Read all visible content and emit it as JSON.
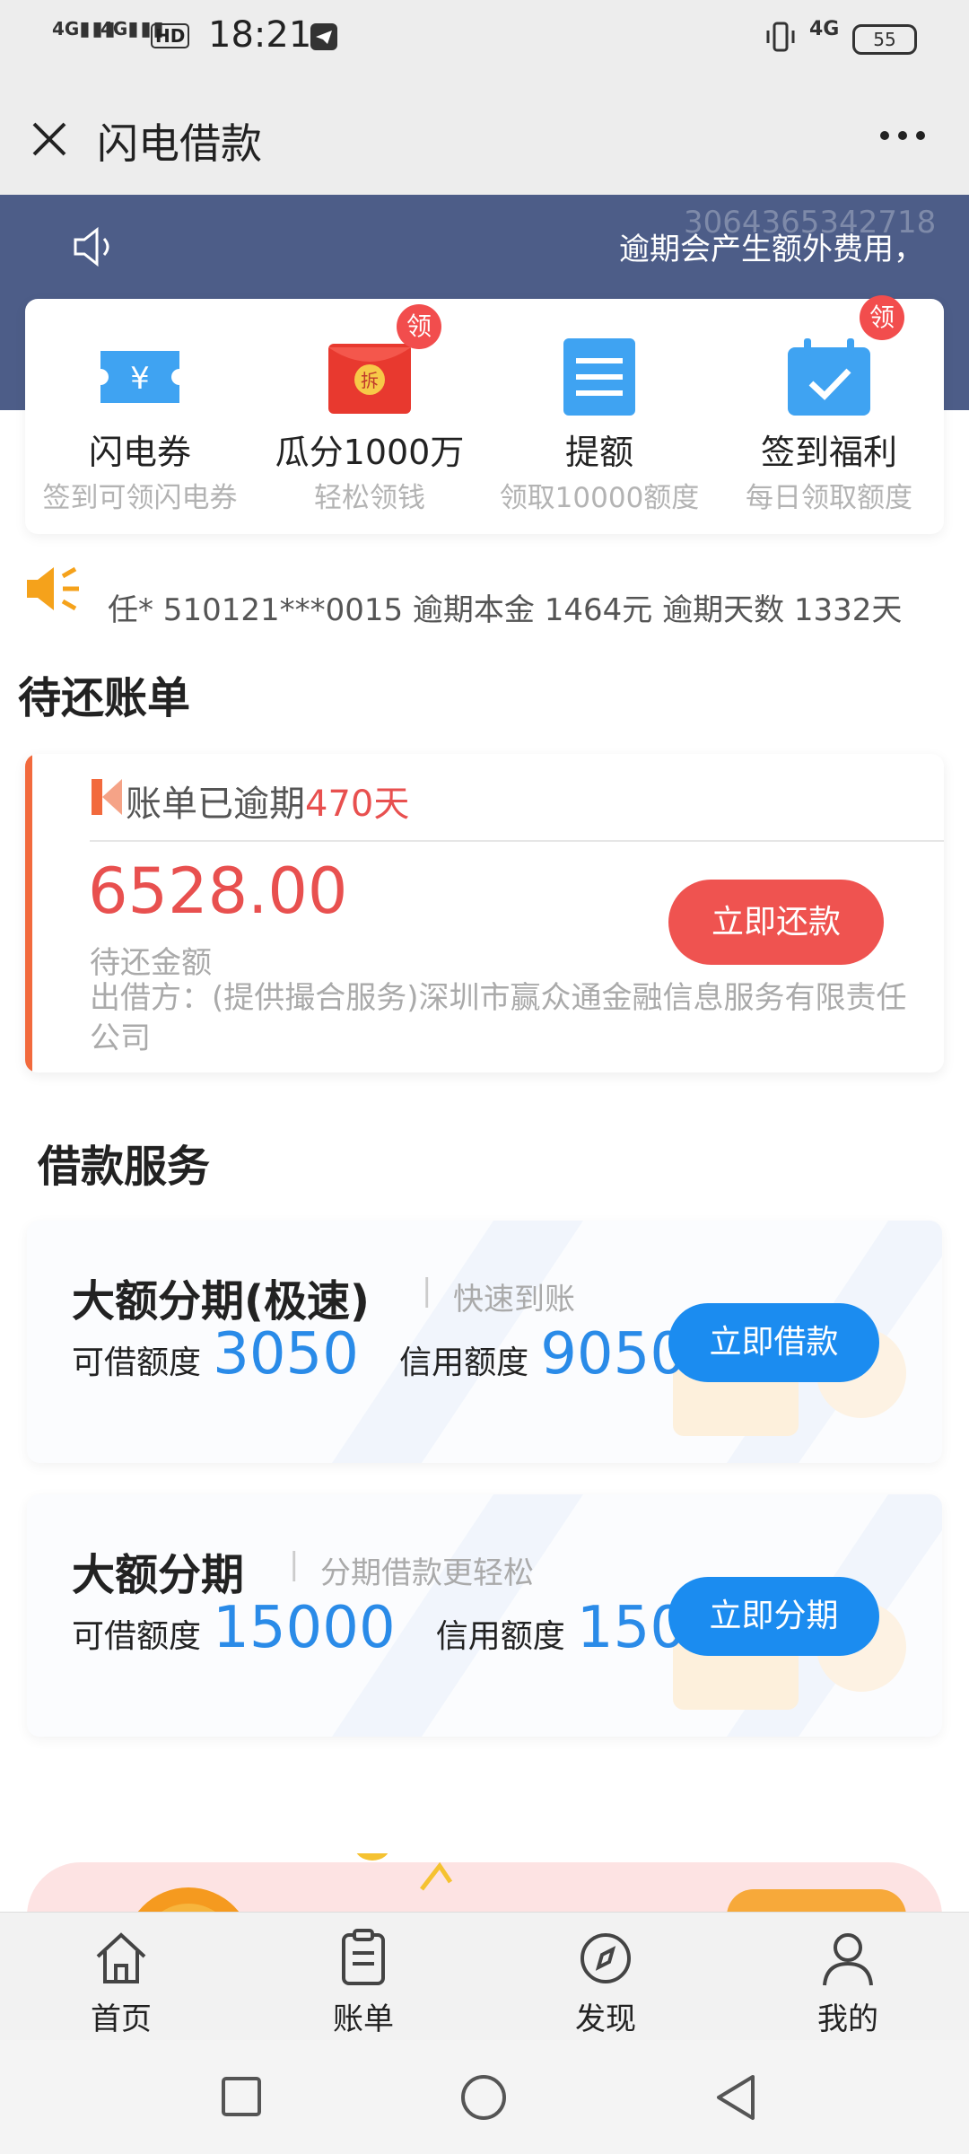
{
  "status_bar": {
    "signal_1": "4G",
    "signal_2": "4G",
    "hd_badge": "HD",
    "time": "18:21",
    "network": "4G",
    "battery": "55"
  },
  "title_bar": {
    "title": "闪电借款"
  },
  "banner": {
    "notice": "逾期会产生额外费用，",
    "watermark": "3064365342718"
  },
  "quick_items": [
    {
      "title": "闪电券",
      "subtitle": "签到可领闪电券",
      "badge": ""
    },
    {
      "title": "瓜分1000万",
      "subtitle": "轻松领钱",
      "badge": "领",
      "icon_text": "拆"
    },
    {
      "title": "提额",
      "subtitle": "领取10000额度",
      "badge": ""
    },
    {
      "title": "签到福利",
      "subtitle": "每日领取额度",
      "badge": "领"
    }
  ],
  "ticker": {
    "text": "任* 510121***0015 逾期本金 1464元 逾期天数 1332天"
  },
  "pending_bill": {
    "section_title": "待还账单",
    "status_prefix": "账单已逾期",
    "overdue_days": "470天",
    "amount": "6528.00",
    "amount_label": "待还金额",
    "lender": "出借方：(提供撮合服务)深圳市赢众通金融信息服务有限责任公司",
    "repay_button": "立即还款"
  },
  "loan_services": {
    "section_title": "借款服务",
    "cards": [
      {
        "title": "大额分期(极速)",
        "subtitle": "快速到账",
        "available_label": "可借额度",
        "available_value": "3050",
        "credit_label": "信用额度",
        "credit_value": "9050",
        "button": "立即借款"
      },
      {
        "title": "大额分期",
        "subtitle": "分期借款更轻松",
        "available_label": "可借额度",
        "available_value": "15000",
        "credit_label": "信用额度",
        "credit_value": "1500",
        "button": "立即分期"
      }
    ]
  },
  "tab_bar": {
    "tabs": [
      "首页",
      "账单",
      "发现",
      "我的"
    ]
  },
  "colors": {
    "banner": "#4d5d88",
    "accent_red": "#e8504f",
    "accent_blue": "#1b8cf0"
  }
}
